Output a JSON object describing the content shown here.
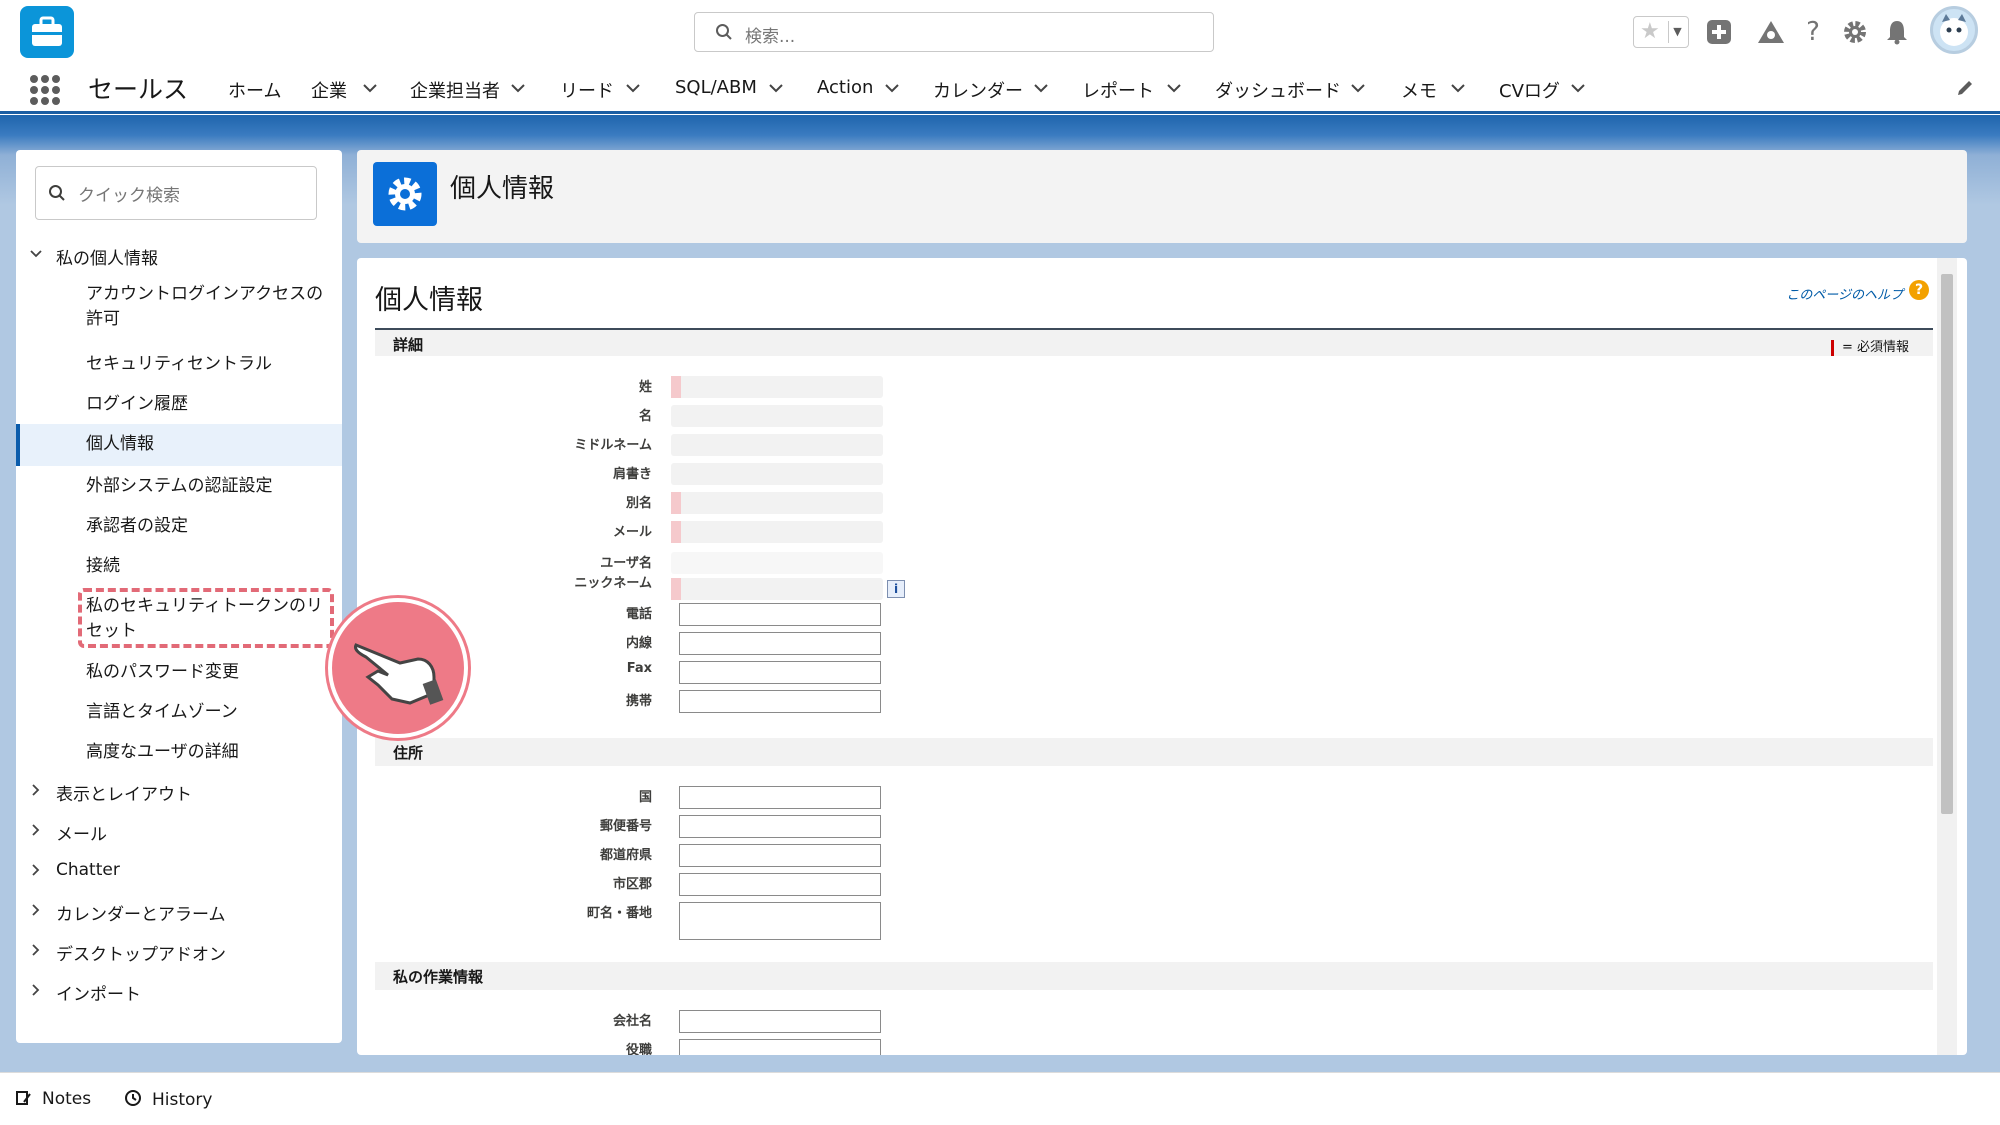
{
  "header": {
    "search_placeholder": "検索..."
  },
  "nav": {
    "app_name": "セールス",
    "items": [
      {
        "label": "ホーム"
      },
      {
        "label": "企業"
      },
      {
        "label": "企業担当者"
      },
      {
        "label": "リード"
      },
      {
        "label": "SQL/ABM"
      },
      {
        "label": "Action"
      },
      {
        "label": "カレンダー"
      },
      {
        "label": "レポート"
      },
      {
        "label": "ダッシュボード"
      },
      {
        "label": "メモ"
      },
      {
        "label": "CVログ"
      }
    ]
  },
  "sidebar": {
    "quick_search_placeholder": "クイック検索",
    "section_open": "私の個人情報",
    "items": [
      "アカウントログインアクセスの許可",
      "セキュリティセントラル",
      "ログイン履歴",
      "個人情報",
      "外部システムの認証設定",
      "承認者の設定",
      "接続",
      "私のセキュリティトークンのリセット",
      "私のパスワード変更",
      "言語とタイムゾーン",
      "高度なユーザの詳細"
    ],
    "selected_item": "個人情報",
    "sections": [
      "表示とレイアウト",
      "メール",
      "Chatter",
      "カレンダーとアラーム",
      "デスクトップアドオン",
      "インポート"
    ]
  },
  "page_header": {
    "title": "個人情報"
  },
  "content": {
    "title": "個人情報",
    "help_link": "このページのヘルプ",
    "required_note": "= 必須情報",
    "sections": {
      "detail": "詳細",
      "address": "住所",
      "work": "私の作業情報"
    },
    "fields": {
      "last_name": "姓",
      "first_name": "名",
      "middle_name": "ミドルネーム",
      "title_suffix": "肩書き",
      "alias": "別名",
      "email": "メール",
      "username": "ユーザ名",
      "nickname": "ニックネーム",
      "phone": "電話",
      "extension": "内線",
      "fax": "Fax",
      "mobile": "携帯",
      "country": "国",
      "postal_code": "郵便番号",
      "state": "都道府県",
      "city": "市区郡",
      "street": "町名・番地",
      "company": "会社名",
      "position": "役職"
    }
  },
  "footer": {
    "notes": "Notes",
    "history": "History"
  },
  "colors": {
    "brand_blue": "#0b6fd8",
    "highlight_pink": "#ee7a87",
    "nav_underline": "#1b5ea3"
  }
}
